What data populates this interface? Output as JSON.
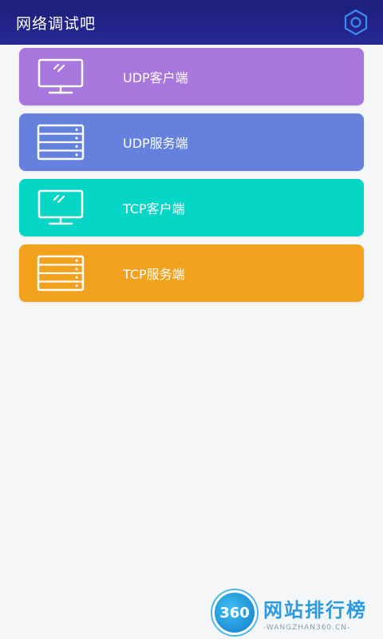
{
  "app_bar": {
    "title": "网络调试吧",
    "settings_icon": "hexagon-settings-icon"
  },
  "menu": [
    {
      "label": "UDP客户端",
      "icon": "monitor-icon",
      "color": "#a876dc"
    },
    {
      "label": "UDP服务端",
      "icon": "server-icon",
      "color": "#6581de"
    },
    {
      "label": "TCP客户端",
      "icon": "monitor-icon",
      "color": "#05d6c6"
    },
    {
      "label": "TCP服务端",
      "icon": "server-icon",
      "color": "#f2a11c"
    }
  ],
  "watermark": {
    "badge": "360",
    "name": "网站排行榜",
    "domain": "-WANGZHAN360.CN-"
  },
  "colors": {
    "app_bar": "#23258c",
    "background": "#f4f6f8",
    "watermark": "#2a9be0"
  }
}
